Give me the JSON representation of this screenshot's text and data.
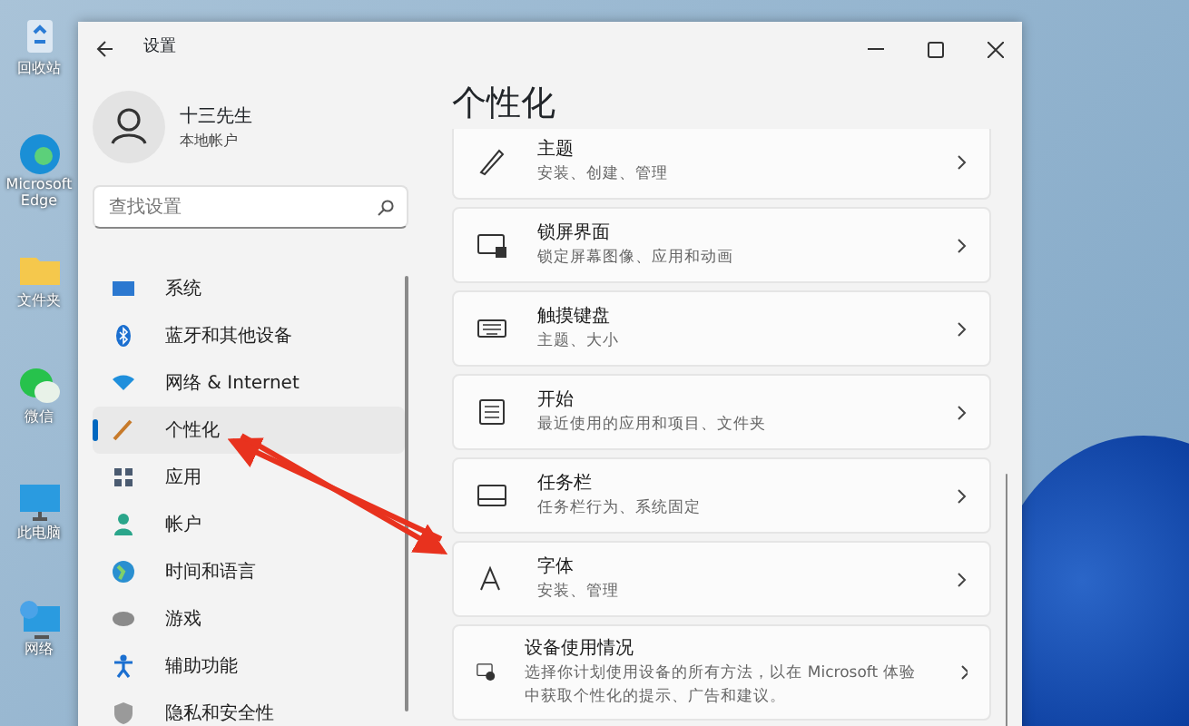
{
  "desktop_icons": [
    {
      "label": "回收站",
      "kind": "recycle"
    },
    {
      "label": "Microsoft Edge",
      "kind": "edge"
    },
    {
      "label": "文件夹",
      "kind": "folder"
    },
    {
      "label": "微信",
      "kind": "chat"
    },
    {
      "label": "此电脑",
      "kind": "monitor"
    },
    {
      "label": "网络",
      "kind": "network"
    }
  ],
  "window": {
    "title": "设置"
  },
  "profile": {
    "name": "十三先生",
    "account": "本地帐户"
  },
  "search": {
    "placeholder": "查找设置"
  },
  "sidebar": {
    "items": [
      {
        "label": "系统",
        "kind": "system",
        "selected": false
      },
      {
        "label": "蓝牙和其他设备",
        "kind": "bluetooth",
        "selected": false
      },
      {
        "label": "网络 & Internet",
        "kind": "wifi",
        "selected": false
      },
      {
        "label": "个性化",
        "kind": "brush",
        "selected": true
      },
      {
        "label": "应用",
        "kind": "apps",
        "selected": false
      },
      {
        "label": "帐户",
        "kind": "person",
        "selected": false
      },
      {
        "label": "时间和语言",
        "kind": "globe",
        "selected": false
      },
      {
        "label": "游戏",
        "kind": "game",
        "selected": false
      },
      {
        "label": "辅助功能",
        "kind": "access",
        "selected": false
      },
      {
        "label": "隐私和安全性",
        "kind": "shield",
        "selected": false
      }
    ]
  },
  "page": {
    "heading": "个性化",
    "cards": [
      {
        "title": "主题",
        "subtitle": "安装、创建、管理",
        "kind": "brush"
      },
      {
        "title": "锁屏界面",
        "subtitle": "锁定屏幕图像、应用和动画",
        "kind": "lock"
      },
      {
        "title": "触摸键盘",
        "subtitle": "主题、大小",
        "kind": "keyboard"
      },
      {
        "title": "开始",
        "subtitle": "最近使用的应用和项目、文件夹",
        "kind": "start"
      },
      {
        "title": "任务栏",
        "subtitle": "任务栏行为、系统固定",
        "kind": "taskbar"
      },
      {
        "title": "字体",
        "subtitle": "安装、管理",
        "kind": "font"
      },
      {
        "title": "设备使用情况",
        "subtitle": "选择你计划使用设备的所有方法，以在 Microsoft 体验中获取个性化的提示、广告和建议。",
        "kind": "device"
      }
    ]
  }
}
